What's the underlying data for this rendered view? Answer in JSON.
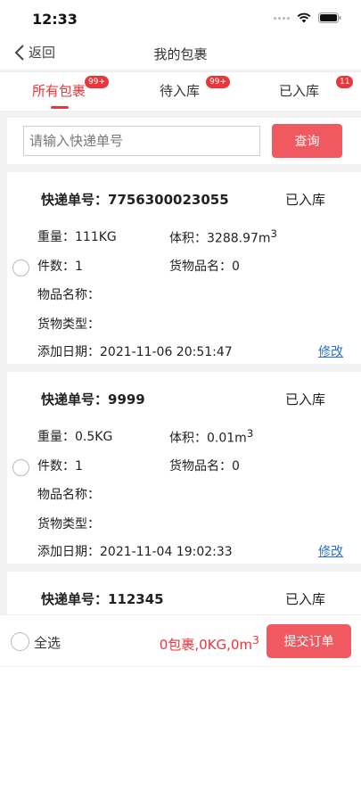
{
  "status_bar": {
    "time": "12:33"
  },
  "nav": {
    "back_label": "返回",
    "title": "我的包裹"
  },
  "tabs": [
    {
      "label": "所有包裹",
      "badge": "99+"
    },
    {
      "label": "待入库",
      "badge": "99+"
    },
    {
      "label": "已入库",
      "badge": "11"
    }
  ],
  "search": {
    "placeholder": "请输入快递单号",
    "button_label": "查询"
  },
  "packages": [
    {
      "tracking": "快递单号：7756300023055",
      "status": "已入库",
      "weight": "重量：111KG",
      "volume": "体积：3288.97m",
      "volume_sup": "3",
      "pieces": "件数：1",
      "goods_name": "货物品名：0",
      "item_name": "物品名称：",
      "goods_type": "货物类型：",
      "date": "添加日期：2021-11-06 20:51:47",
      "edit_label": "修改"
    },
    {
      "tracking": "快递单号：9999",
      "status": "已入库",
      "weight": "重量：0.5KG",
      "volume": "体积：0.01m",
      "volume_sup": "3",
      "pieces": "件数：1",
      "goods_name": "货物品名：0",
      "item_name": "物品名称：",
      "goods_type": "货物类型：",
      "date": "添加日期：2021-11-04 19:02:33",
      "edit_label": "修改"
    },
    {
      "tracking": "快递单号：112345",
      "status": "已入库"
    }
  ],
  "footer": {
    "select_all_label": "全选",
    "summary": "0包裹,0KG,0m",
    "summary_sup": "3",
    "submit_label": "提交订单"
  },
  "colors": {
    "accent": "#e8363b",
    "button": "#f0595f",
    "link": "#2a6fd6"
  }
}
